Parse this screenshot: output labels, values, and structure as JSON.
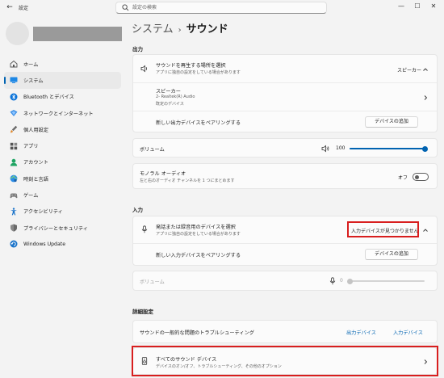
{
  "window": {
    "app_title": "設定",
    "search_placeholder": "設定の検索"
  },
  "sidebar": {
    "items": [
      {
        "label": "ホーム",
        "icon": "home-icon"
      },
      {
        "label": "システム",
        "icon": "system-icon",
        "active": true
      },
      {
        "label": "Bluetooth とデバイス",
        "icon": "bluetooth-icon"
      },
      {
        "label": "ネットワークとインターネット",
        "icon": "network-icon"
      },
      {
        "label": "個人用設定",
        "icon": "personalization-icon"
      },
      {
        "label": "アプリ",
        "icon": "apps-icon"
      },
      {
        "label": "アカウント",
        "icon": "account-icon"
      },
      {
        "label": "時刻と言語",
        "icon": "time-language-icon"
      },
      {
        "label": "ゲーム",
        "icon": "gaming-icon"
      },
      {
        "label": "アクセシビリティ",
        "icon": "accessibility-icon"
      },
      {
        "label": "プライバシーとセキュリティ",
        "icon": "privacy-shield-icon"
      },
      {
        "label": "Windows Update",
        "icon": "windows-update-icon"
      }
    ]
  },
  "breadcrumb": {
    "parent": "システム",
    "separator": "›",
    "current": "サウンド"
  },
  "output": {
    "section_title": "出力",
    "choose_device": {
      "title": "サウンドを再生する場所を選択",
      "subtitle": "アプリに独自の設定をしている場合があります",
      "selected": "スピーカー"
    },
    "speaker": {
      "title": "スピーカー",
      "line1": "2- Realtek(R) Audio",
      "line2": "既定のデバイス"
    },
    "pair": {
      "label": "新しい出力デバイスをペアリングする",
      "button": "デバイスの追加"
    },
    "volume": {
      "label": "ボリューム",
      "value": "100",
      "level": 1.0
    },
    "mono": {
      "title": "モノラル オーディオ",
      "subtitle": "左と右のオーディオ チャンネルを 1 つにまとめます",
      "state": "オフ"
    }
  },
  "input": {
    "section_title": "入力",
    "choose_device": {
      "title": "発話または録音用のデバイスを選択",
      "subtitle": "アプリに独自の設定をしている場合があります",
      "status": "入力デバイスが見つかりません"
    },
    "pair": {
      "label": "新しい入力デバイスをペアリングする",
      "button": "デバイスの追加"
    },
    "volume": {
      "label": "ボリューム",
      "value": "0",
      "level": 0.0
    }
  },
  "advanced": {
    "section_title": "詳細設定",
    "troubleshoot": {
      "label": "サウンドの一般的な問題のトラブルシューティング",
      "output_link": "出力デバイス",
      "input_link": "入力デバイス"
    },
    "all_devices": {
      "title": "すべてのサウンド デバイス",
      "subtitle": "デバイスのオン/オフ、トラブルシューティング、その他のオプション"
    }
  },
  "colors": {
    "accent": "#0063b1",
    "highlight_box": "#d81e1e",
    "background": "#f3f3f3",
    "card": "#fbfbfb"
  }
}
